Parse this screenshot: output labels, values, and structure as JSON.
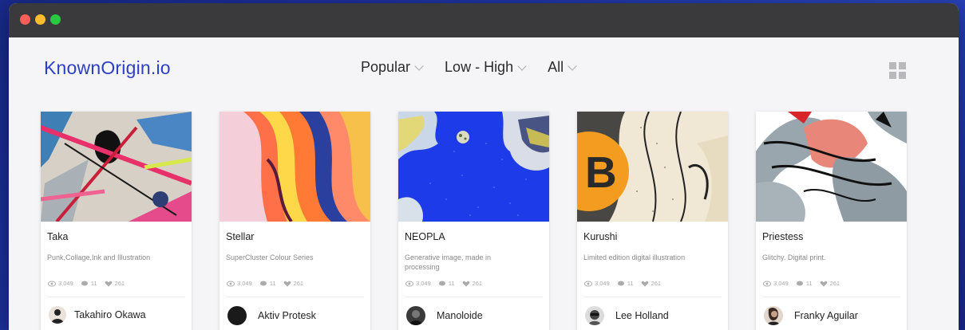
{
  "brand": {
    "logo": "KnownOrigin.io"
  },
  "filters": [
    {
      "label": "Popular"
    },
    {
      "label": "Low - High"
    },
    {
      "label": "All"
    }
  ],
  "cards": [
    {
      "title": "Taka",
      "description": "Punk,Collage,Ink and Illustration",
      "views": "3,049",
      "comments": "11",
      "likes": "261",
      "author": "Takahiro Okawa"
    },
    {
      "title": "Stellar",
      "description": "SuperCluster Colour Series",
      "views": "3,049",
      "comments": "11",
      "likes": "261",
      "author": "Aktiv Protesk"
    },
    {
      "title": "NEOPLA",
      "description": "Generative image, made in processing",
      "views": "3,049",
      "comments": "11",
      "likes": "261",
      "author": "Manoloide"
    },
    {
      "title": "Kurushi",
      "description": "Limited edition digital illustration",
      "views": "3,049",
      "comments": "11",
      "likes": "261",
      "author": "Lee Holland"
    },
    {
      "title": "Priestess",
      "description": "Glitchy. Digital print.",
      "views": "3,049",
      "comments": "11",
      "likes": "261",
      "author": "Franky Aguilar"
    }
  ],
  "colors": {
    "brand": "#2d3fc2",
    "titlebar": "#3a3a3c",
    "page_bg": "#f5f5f7"
  }
}
